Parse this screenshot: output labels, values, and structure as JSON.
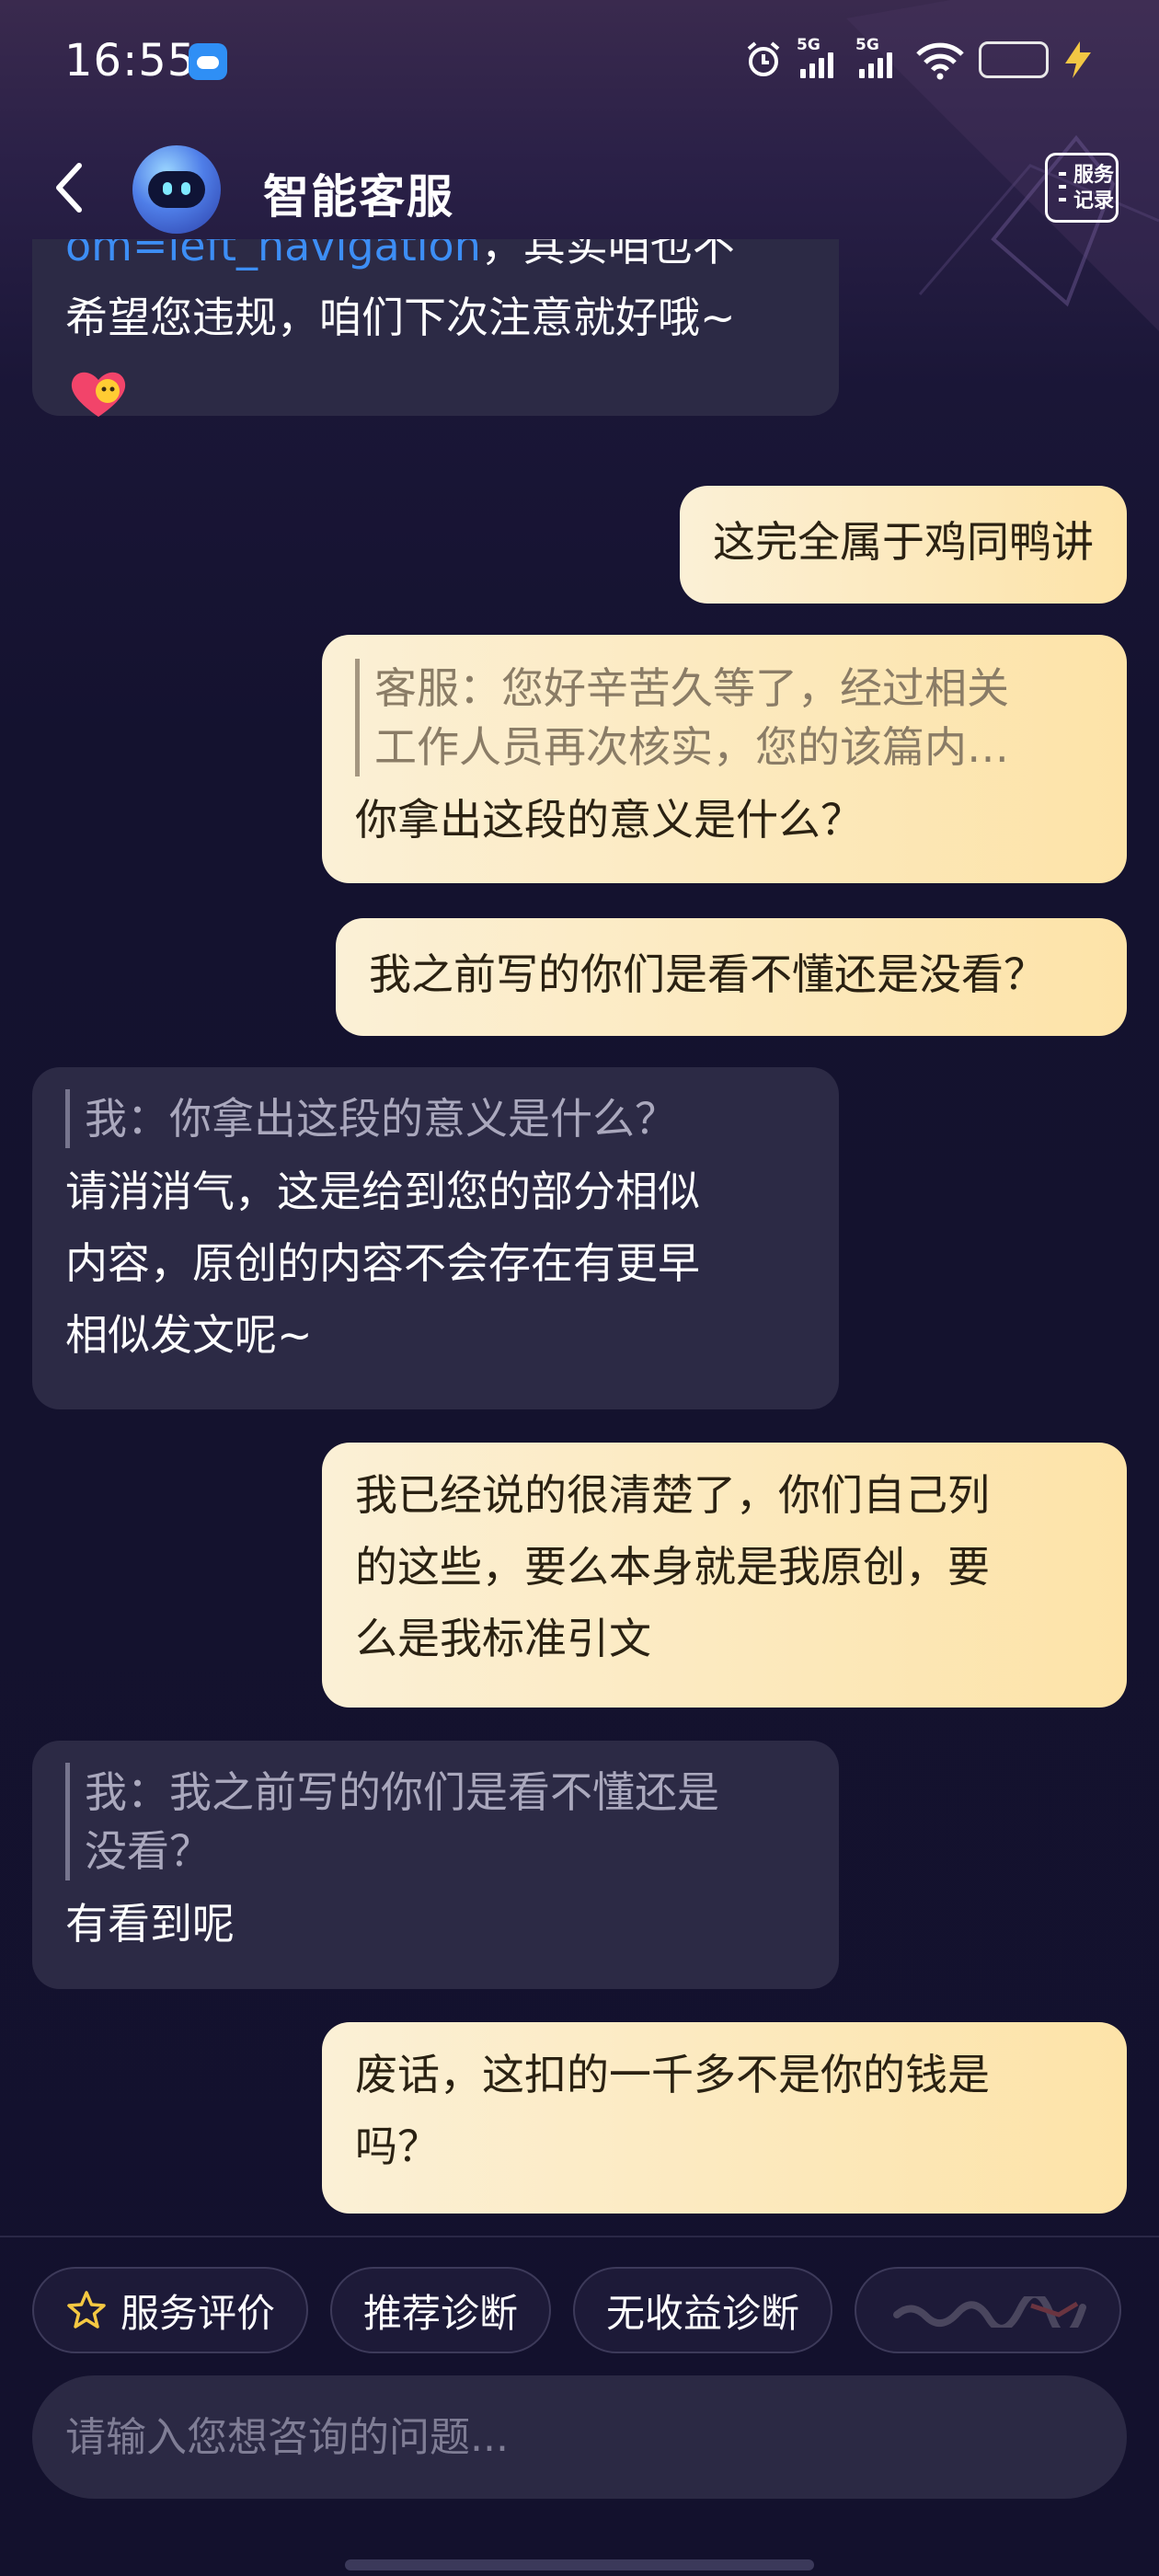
{
  "status_bar": {
    "time": "16:55",
    "network_1": "5G",
    "network_2": "5G",
    "icons": [
      "weather-icon",
      "alarm-icon",
      "signal-icon",
      "signal-icon",
      "wifi-icon",
      "battery-icon",
      "charging-icon"
    ],
    "battery_color": "#3ee04a"
  },
  "header": {
    "title": "智能客服",
    "service_record_line1": "服务",
    "service_record_line2": "记录"
  },
  "messages": [
    {
      "role": "bot",
      "link": "om=left_navigation",
      "line1_rest": "，其实咱也不",
      "line2": "希望您违规，咱们下次注意就好哦~"
    },
    {
      "role": "user",
      "text": "这完全属于鸡同鸭讲"
    },
    {
      "role": "user",
      "quote_line1": "客服：您好辛苦久等了，经过相关",
      "quote_line2": "工作人员再次核实，您的该篇内…",
      "text": "你拿出这段的意义是什么？"
    },
    {
      "role": "user",
      "text": "我之前写的你们是看不懂还是没看？"
    },
    {
      "role": "bot",
      "quote": "我：你拿出这段的意义是什么？",
      "lines": [
        "请消消气，这是给到您的部分相似",
        "内容，原创的内容不会存在有更早",
        "相似发文呢~"
      ]
    },
    {
      "role": "user",
      "lines": [
        "我已经说的很清楚了，你们自己列",
        "的这些，要么本身就是我原创，要",
        "么是我标准引文"
      ]
    },
    {
      "role": "bot",
      "quote_line1": "我：我之前写的你们是看不懂还是",
      "quote_line2": "没看？",
      "text": "有看到呢"
    },
    {
      "role": "user",
      "lines": [
        "废话，这扣的一千多不是你的钱是",
        "吗？"
      ]
    }
  ],
  "quick_actions": [
    {
      "label": "服务评价",
      "icon": "star-icon"
    },
    {
      "label": "推荐诊断"
    },
    {
      "label": "无收益诊断"
    }
  ],
  "input": {
    "placeholder": "请输入您想咨询的问题..."
  },
  "colors": {
    "background": "#15122e",
    "bot_bubble": "#2c2a45",
    "user_bubble": "#fde3a8",
    "link": "#3d8ef5"
  }
}
